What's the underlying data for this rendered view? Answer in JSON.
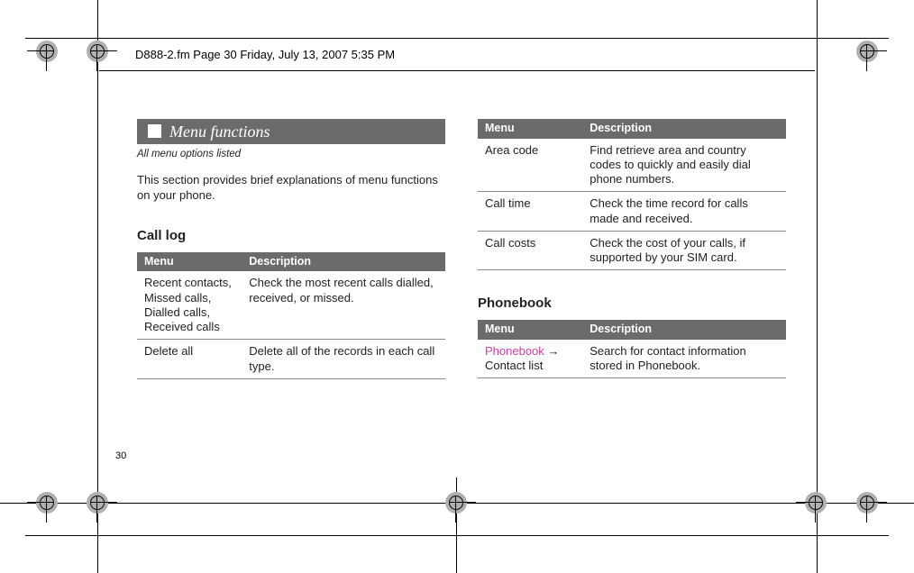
{
  "header": "D888-2.fm  Page 30  Friday, July 13, 2007  5:35 PM",
  "banner": {
    "title": "Menu functions",
    "subtitle": "All menu options listed"
  },
  "intro": "This section provides brief explanations of menu functions on your phone.",
  "call_log": {
    "heading": "Call log",
    "th_menu": "Menu",
    "th_desc": "Description",
    "rows": [
      {
        "menu": "Recent contacts, Missed calls, Dialled calls, Received calls",
        "desc": "Check the most recent calls dialled, received, or missed."
      },
      {
        "menu": "Delete all",
        "desc": "Delete all of the records in each call type."
      }
    ]
  },
  "call_log_cont": {
    "th_menu": "Menu",
    "th_desc": "Description",
    "rows": [
      {
        "menu": "Area code",
        "desc": "Find retrieve area and country codes to quickly and easily dial phone numbers."
      },
      {
        "menu": "Call time",
        "desc": "Check the time record for calls made and received."
      },
      {
        "menu": "Call costs",
        "desc": "Check the cost of your calls, if supported by your SIM card."
      }
    ]
  },
  "phonebook": {
    "heading": "Phonebook",
    "th_menu": "Menu",
    "th_desc": "Description",
    "rows": [
      {
        "menu_hl": "Phonebook",
        "menu_tail": "Contact list",
        "arrow": "→",
        "desc": "Search for contact information stored in Phonebook."
      }
    ]
  },
  "page_number": "30"
}
